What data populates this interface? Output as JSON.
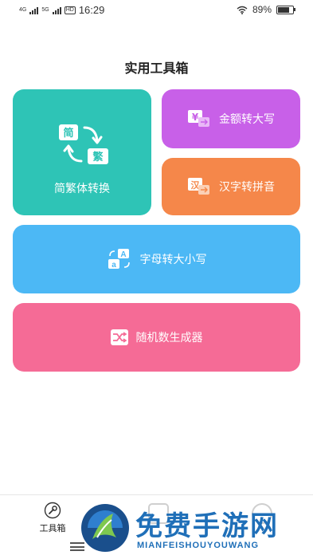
{
  "status_bar": {
    "time": "16:29",
    "network_4g": "4G",
    "network_5g": "5G",
    "hd_badge": "HD",
    "battery_text": "89%",
    "battery_level": 0.89
  },
  "page": {
    "title": "实用工具箱"
  },
  "tools": {
    "convert": {
      "label": "简繁体转换",
      "box_simplified": "简",
      "box_traditional": "繁",
      "color": "#2ec4b6"
    },
    "money": {
      "label": "金额转大写",
      "icon_text": "¥",
      "color": "#c860e8"
    },
    "pinyin": {
      "label": "汉字转拼音",
      "icon_text": "汉",
      "color": "#f5874a"
    },
    "letter_case": {
      "label": "字母转大小写",
      "icon_upper": "A",
      "icon_lower": "a",
      "color": "#4cb8f5"
    },
    "random": {
      "label": "随机数生成器",
      "color": "#f56b96"
    }
  },
  "tab_bar": {
    "tools_label": "工具箱"
  },
  "watermark": {
    "title": "免费手游网",
    "subtitle": "MIANFEISHOUYOUWANG"
  }
}
